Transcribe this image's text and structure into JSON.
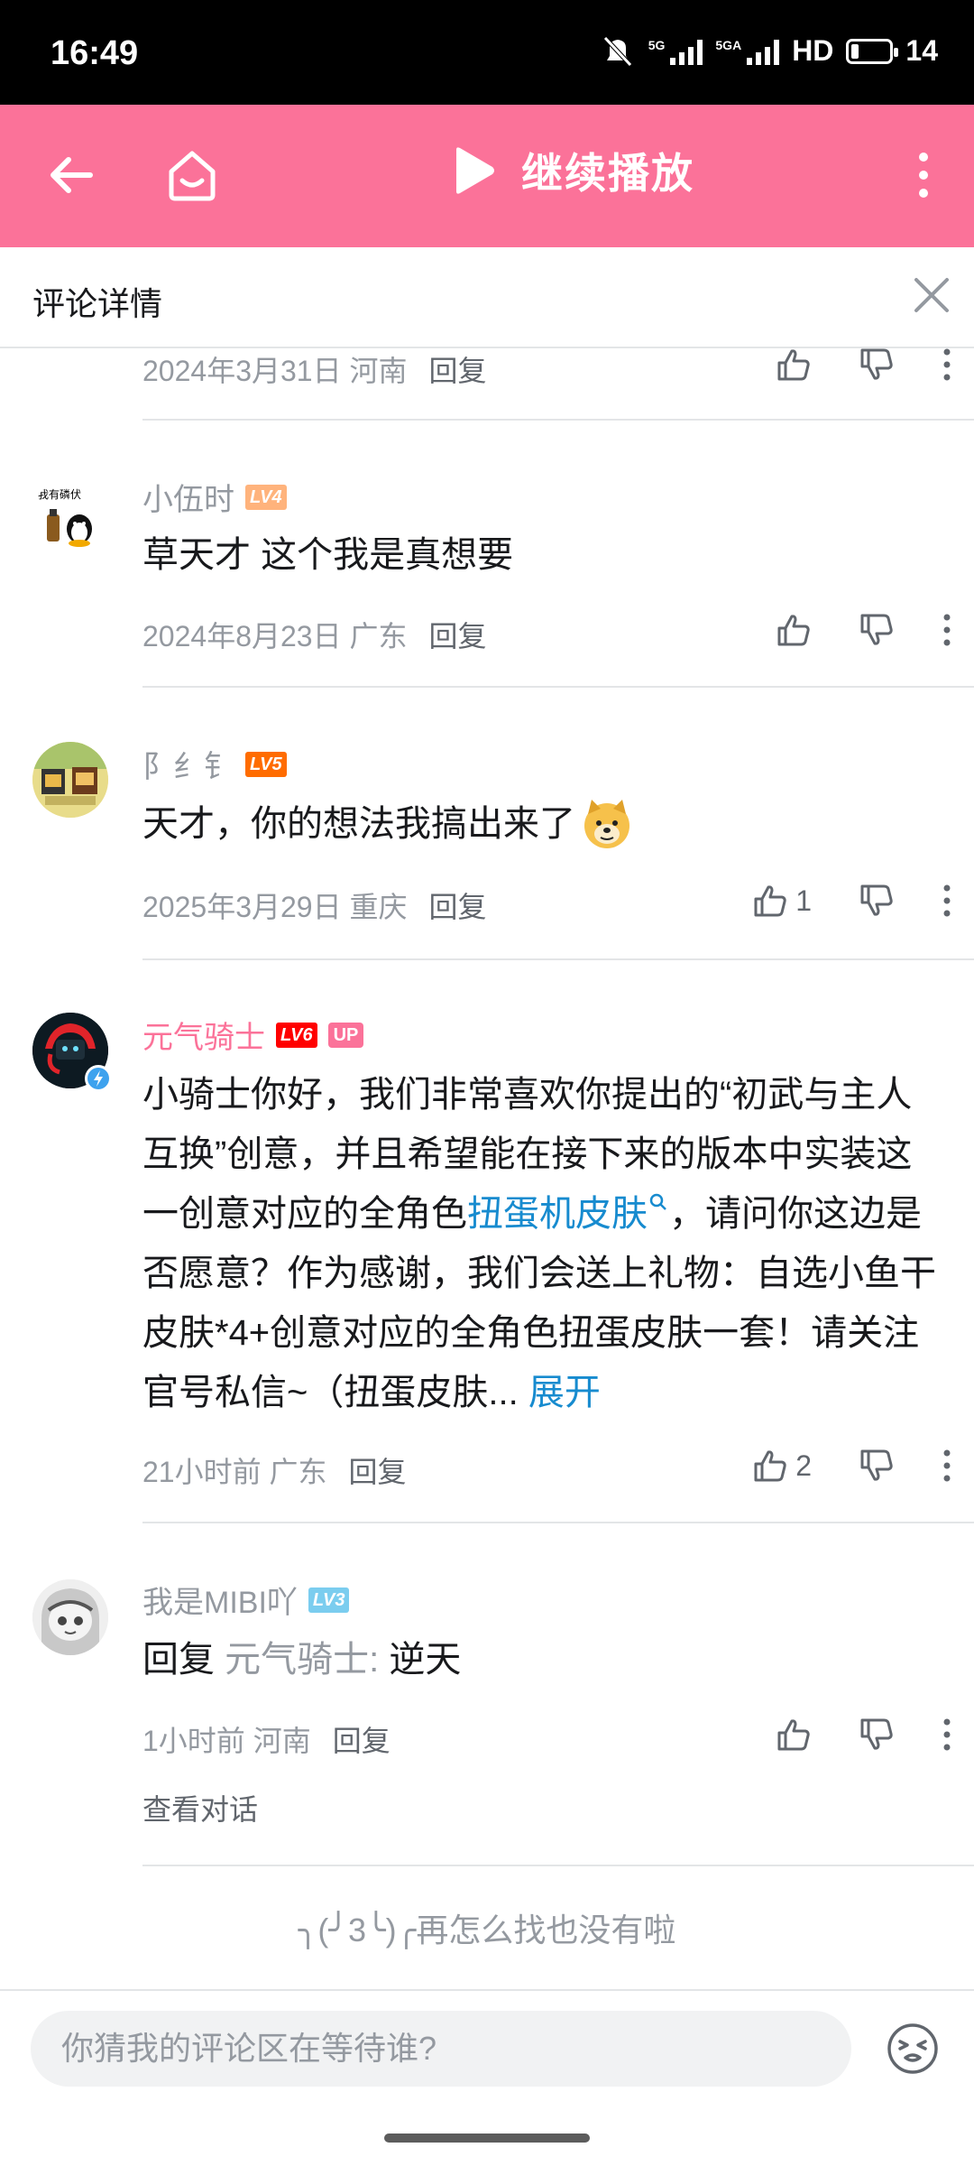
{
  "status_bar": {
    "time": "16:49",
    "net1": "5G",
    "net2": "5GA",
    "hd": "HD",
    "battery": "14"
  },
  "topbar": {
    "play_label": "继续播放"
  },
  "detail": {
    "title": "评论详情"
  },
  "comments": [
    {
      "id": "partial",
      "date": "2024年3月31日 河南",
      "reply_label": "回复"
    },
    {
      "id": "c1",
      "username": "小伍时",
      "level": "LV4",
      "text": "草天才 这个我是真想要",
      "date": "2024年8月23日 广东",
      "reply_label": "回复",
      "likes": ""
    },
    {
      "id": "c2",
      "username": "阝纟钅",
      "level": "LV5",
      "text": "天才，你的想法我搞出来了",
      "date": "2025年3月29日 重庆",
      "reply_label": "回复",
      "likes": "1"
    },
    {
      "id": "c3",
      "username": "元气骑士",
      "level": "LV6",
      "badge": "UP",
      "text_part1": "小骑士你好，我们非常喜欢你提出的“初武与主人互换”创意，并且希望能在接下来的版本中实装这一创意对应的全角色",
      "link": "扭蛋机皮肤",
      "text_part2": "，请问你这边是否愿意？作为感谢，我们会送上礼物：自选小鱼干皮肤*4+创意对应的全角色扭蛋皮肤一套！请关注官号私信~（扭蛋皮肤...",
      "expand": "展开",
      "date": "21小时前 广东",
      "reply_label": "回复",
      "likes": "2"
    },
    {
      "id": "c4",
      "username": "我是MIBI吖",
      "level": "LV3",
      "reply_prefix": "回复",
      "reply_to": "元气骑士:",
      "text": "逆天",
      "date": "1小时前 河南",
      "reply_label": "回复",
      "likes": "",
      "view_conversation": "查看对话"
    }
  ],
  "end_tip": "╮(╯3╰)╭再怎么找也没有啦",
  "input": {
    "placeholder": "你猜我的评论区在等待谁?"
  },
  "colors": {
    "brand_pink": "#fb7299",
    "link_blue": "#178bcf",
    "gray_text": "#9499a0"
  }
}
